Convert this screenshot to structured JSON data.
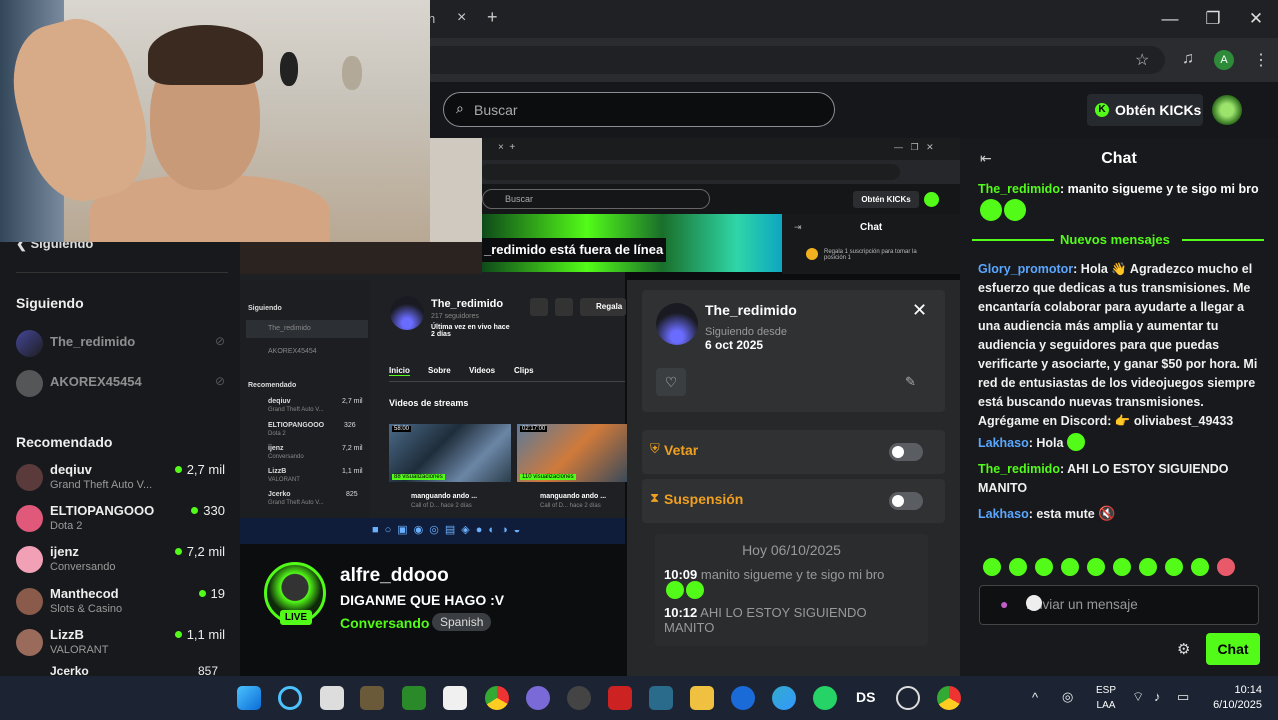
{
  "browser": {
    "tab_fragment": "h",
    "tab_close": "×",
    "new_tab": "+",
    "window_controls": [
      "—",
      "❐",
      "✕"
    ],
    "profile_letter": "A"
  },
  "kick": {
    "search_placeholder": "Buscar",
    "kicks_button": "Obtén KICKs",
    "accent": "#53fc18"
  },
  "sidebar": {
    "section_header": "Siguiendo",
    "following_title": "Siguiendo",
    "following": [
      {
        "name": "The_redimido"
      },
      {
        "name": "AKOREX45454"
      }
    ],
    "recommended_title": "Recomendado",
    "recommended": [
      {
        "name": "deqiuv",
        "category": "Grand Theft Auto V...",
        "viewers": "2,7 mil"
      },
      {
        "name": "ELTIOPANGOOO",
        "category": "Dota 2",
        "viewers": "330"
      },
      {
        "name": "ijenz",
        "category": "Conversando",
        "viewers": "7,2 mil"
      },
      {
        "name": "Manthecod",
        "category": "Slots & Casino",
        "viewers": "19"
      },
      {
        "name": "LizzB",
        "category": "VALORANT",
        "viewers": "1,1 mil"
      },
      {
        "name": "Jcerko",
        "category": "",
        "viewers": "857"
      }
    ]
  },
  "nested": {
    "search": "Buscar",
    "kicks": "Obtén KICKs",
    "offline_banner": "_redimido está fuera de línea",
    "chat_title": "Chat",
    "chat_note": "Regala 1 suscripción para tomar la posición 1",
    "channel_name": "The_redimido",
    "followers": "217 seguidores",
    "last_live": "Última vez en vivo hace 2 días",
    "gift_button": "Regala",
    "tabs": [
      "Inicio",
      "Sobre",
      "Videos",
      "Clips"
    ],
    "streams_title": "Videos de streams",
    "videos": [
      {
        "duration": "58:00",
        "title": "manguando ando ...",
        "meta": "Call of D... hace 2 días",
        "views": "88 visualizaciones"
      },
      {
        "duration": "02:17:00",
        "title": "manguando ando ...",
        "meta": "Call of D... hace 2 días",
        "views": "110 visualizaciones"
      }
    ],
    "side_following": [
      "Siguiendo",
      "The_redimido",
      "AKOREX45454"
    ],
    "side_recommended_title": "Recomendado",
    "side_recommended": [
      {
        "name": "deqiuv",
        "cat": "Grand Theft Auto V...",
        "v": "2,7 mil"
      },
      {
        "name": "ELTIOPANGOOO",
        "cat": "Dota 2",
        "v": "326"
      },
      {
        "name": "ijenz",
        "cat": "Conversando",
        "v": "7,2 mil"
      },
      {
        "name": "LizzB",
        "cat": "VALORANT",
        "v": "1,1 mil"
      },
      {
        "name": "Jcerko",
        "cat": "Grand Theft Auto V...",
        "v": "825"
      }
    ]
  },
  "live": {
    "badge": "LIVE",
    "streamer": "alfre_ddooo",
    "title": "DIGANME QUE HAGO :V",
    "category": "Conversando",
    "language": "Spanish"
  },
  "modal": {
    "username": "The_redimido",
    "following_since_label": "Siguiendo desde",
    "following_since_date": "6 oct 2025",
    "close": "✕",
    "veto_label": "Vetar",
    "suspension_label": "Suspensión",
    "history_header": "Hoy 06/10/2025",
    "history": [
      {
        "time": "10:09",
        "text": "manito sigueme y te sigo mi bro"
      },
      {
        "time": "10:12",
        "text": "AHI LO ESTOY SIGUIENDO MANITO"
      }
    ]
  },
  "chat": {
    "title": "Chat",
    "first": {
      "user": "The_redimido",
      "text": ": manito sigueme y te sigo mi bro"
    },
    "new_messages": "Nuevos mensajes",
    "messages": [
      {
        "user": "Glory_promotor",
        "text": ": Hola 👋 Agradezco mucho el esfuerzo que dedicas a tus transmisiones. Me encantaría colaborar para ayudarte a llegar a una audiencia más amplia y aumentar tu audiencia y seguidores para que puedas verificarte y asociarte, y ganar $50 por hora. Mi red de entusiastas de los videojuegos siempre está buscando nuevas transmisiones. Agrégame en Discord: 👉 oliviabest_49433",
        "color": "blue"
      },
      {
        "user": "Lakhaso",
        "text": ": Hola",
        "color": "blue"
      },
      {
        "user": "The_redimido",
        "text": ": AHI LO ESTOY SIGUIENDO MANITO",
        "color": "green"
      },
      {
        "user": "Lakhaso",
        "text": ": esta mute",
        "color": "blue"
      }
    ],
    "input_placeholder": "Enviar un mensaje",
    "send_button": "Chat"
  },
  "taskbar": {
    "lang": "ESP",
    "lang2": "LAA",
    "time": "10:14",
    "date": "6/10/2025"
  }
}
